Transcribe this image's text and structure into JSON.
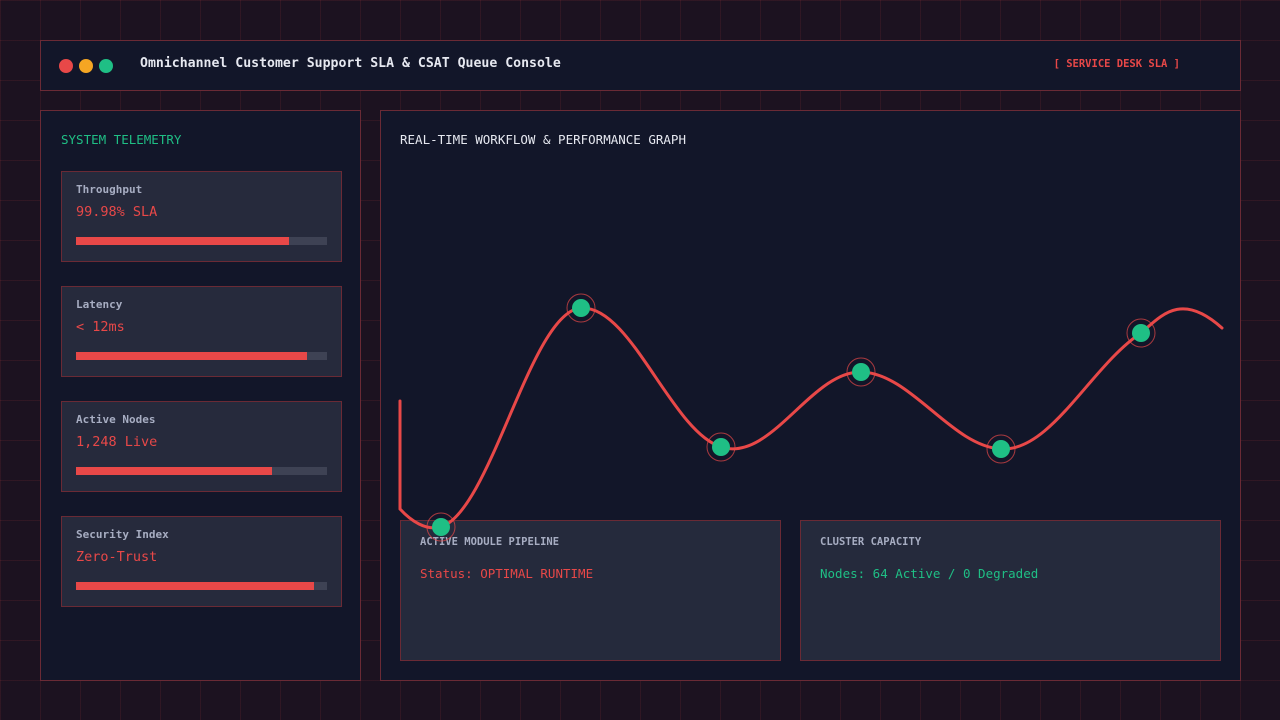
{
  "header": {
    "title": "Omnichannel Customer Support SLA & CSAT Queue Console",
    "badge": "[ SERVICE DESK SLA ]",
    "window_controls": [
      {
        "name": "close",
        "color": "#e84848"
      },
      {
        "name": "minimize",
        "color": "#f5a623"
      },
      {
        "name": "maximize",
        "color": "#1fbf85"
      }
    ]
  },
  "telemetry": {
    "title": "SYSTEM TELEMETRY",
    "metrics": [
      {
        "label": "Throughput",
        "value": "99.98% SLA",
        "fill": 0.85
      },
      {
        "label": "Latency",
        "value": "< 12ms",
        "fill": 0.92
      },
      {
        "label": "Active Nodes",
        "value": "1,248 Live",
        "fill": 0.78
      },
      {
        "label": "Security Index",
        "value": "Zero-Trust",
        "fill": 0.95
      }
    ]
  },
  "graph": {
    "title": "REAL-TIME WORKFLOW & PERFORMANCE GRAPH",
    "line_color": "#e84848",
    "node_color": "#1fbf85"
  },
  "pipeline": {
    "title": "ACTIVE MODULE PIPELINE",
    "status_label": "Status: OPTIMAL RUNTIME"
  },
  "cluster": {
    "title": "CLUSTER CAPACITY",
    "status_label": "Nodes: 64 Active / 0 Degraded"
  },
  "colors": {
    "accent": "#e84848",
    "success": "#1fbf85",
    "warning": "#f5a623",
    "panel_bg": "#121629",
    "border": "#6a2a35"
  }
}
